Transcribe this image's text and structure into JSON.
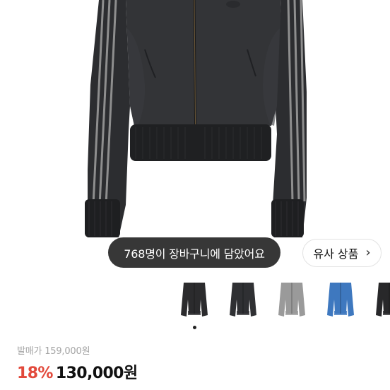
{
  "hero": {
    "image_icon": "product-jacket-image"
  },
  "toast": {
    "text": "768명이 장바구니에 담았어요"
  },
  "similar": {
    "label": "유사 상품",
    "icon": "chevron-right-icon"
  },
  "thumbnails": [
    {
      "color": "#2b2b2d"
    },
    {
      "color": "#2f3033"
    },
    {
      "color": "#9a9a9a"
    },
    {
      "color": "#3e78bf"
    },
    {
      "color": "#28282a"
    }
  ],
  "price": {
    "retail_label": "발매가",
    "retail_value": "159,000원",
    "discount": "18%",
    "sale_value": "130,000원"
  }
}
